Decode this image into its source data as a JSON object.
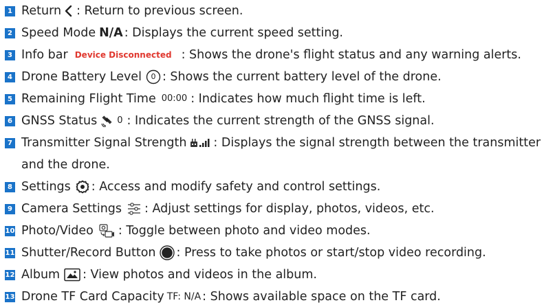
{
  "items": [
    {
      "num": "1",
      "label": "Return",
      "icon": "chevron-left-icon",
      "desc": ": Return to previous screen."
    },
    {
      "num": "2",
      "label": "Speed Mode",
      "value": "N/A",
      "desc": ": Displays the current speed setting."
    },
    {
      "num": "3",
      "label": "Info bar",
      "value": "Device Disconnected",
      "desc": ": Shows the drone's flight status and any warning alerts."
    },
    {
      "num": "4",
      "label": "Drone Battery Level",
      "value": "0",
      "icon": "battery-circle-icon",
      "desc": ": Shows the current battery level of the drone."
    },
    {
      "num": "5",
      "label": "Remaining Flight Time",
      "value": "00:00",
      "desc": ": Indicates how much flight time is left."
    },
    {
      "num": "6",
      "label": "GNSS Status",
      "value": "0",
      "icon": "satellite-icon",
      "desc": ": Indicates the current strength of the GNSS signal."
    },
    {
      "num": "7",
      "label": "Transmitter Signal Strength",
      "icon": "transmitter-signal-icon",
      "desc": ": Displays the signal strength between the transmitter",
      "desc2": "and the drone."
    },
    {
      "num": "8",
      "label": "Settings",
      "icon": "gear-icon",
      "desc": ": Access and modify safety and control settings."
    },
    {
      "num": "9",
      "label": "Camera Settings",
      "icon": "sliders-icon",
      "desc": ": Adjust settings for display, photos, videos, etc."
    },
    {
      "num": "10",
      "label": "Photo/Video",
      "icon": "photo-video-switch-icon",
      "desc": ": Toggle between photo and video modes."
    },
    {
      "num": "11",
      "label": "Shutter/Record Button",
      "icon": "shutter-button-icon",
      "desc": ": Press to take photos or start/stop video recording."
    },
    {
      "num": "12",
      "label": "Album",
      "icon": "album-icon",
      "desc": ": View photos and videos in the album."
    },
    {
      "num": "13",
      "label": "Drone TF Card Capacity",
      "value": "TF: N/A",
      "desc": ": Shows available space on the TF card."
    }
  ],
  "colors": {
    "badge": "#1a73c9",
    "alert": "#e0382f",
    "text": "#222222"
  }
}
